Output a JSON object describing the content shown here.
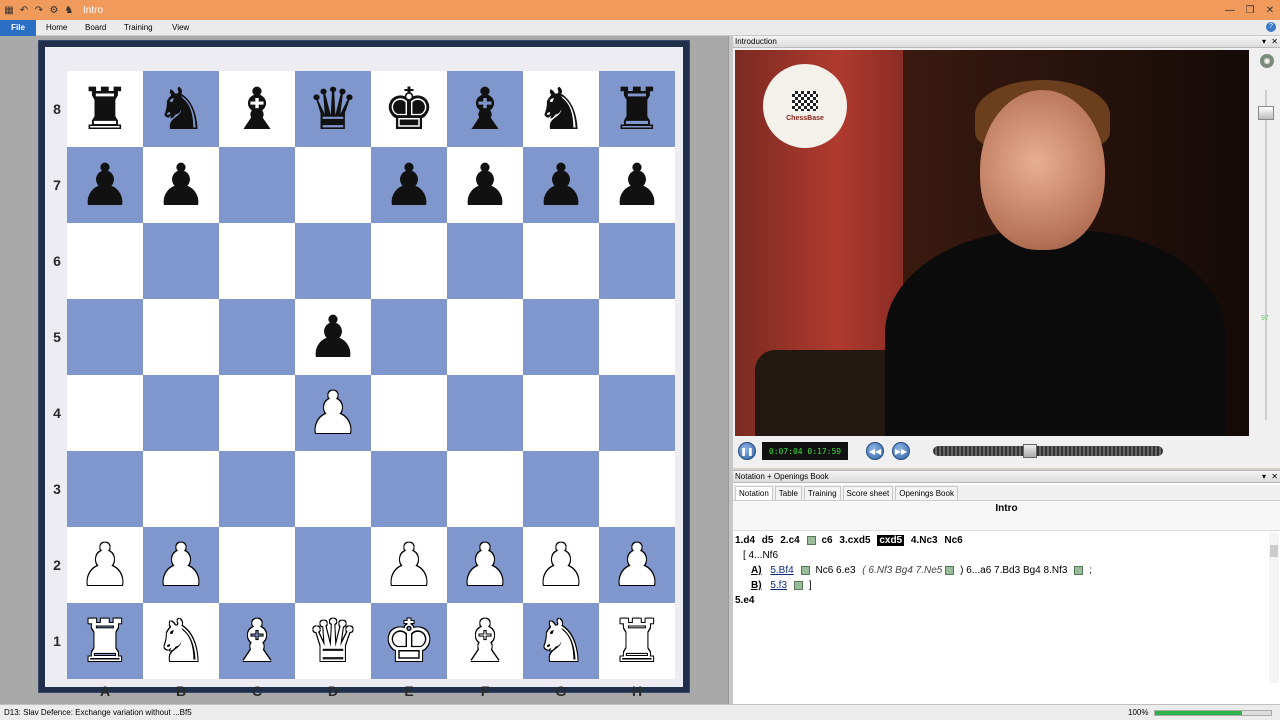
{
  "window": {
    "title": "Intro"
  },
  "menu": {
    "tabs": [
      "File",
      "Home",
      "Board",
      "Training",
      "View"
    ]
  },
  "board": {
    "files": [
      "A",
      "B",
      "C",
      "D",
      "E",
      "F",
      "G",
      "H"
    ],
    "ranks": [
      "8",
      "7",
      "6",
      "5",
      "4",
      "3",
      "2",
      "1"
    ],
    "light_color": "#ffffff",
    "dark_color": "#7f97cd",
    "position": [
      [
        "br",
        "bn",
        "bb",
        "bq",
        "bk",
        "bb",
        "bn",
        "br"
      ],
      [
        "bp",
        "bp",
        "",
        "",
        "bp",
        "bp",
        "bp",
        "bp"
      ],
      [
        "",
        "",
        "",
        "",
        "",
        "",
        "",
        ""
      ],
      [
        "",
        "",
        "",
        "bp",
        "",
        "",
        "",
        ""
      ],
      [
        "",
        "",
        "",
        "wp",
        "",
        "",
        "",
        ""
      ],
      [
        "",
        "",
        "",
        "",
        "",
        "",
        "",
        ""
      ],
      [
        "wp",
        "wp",
        "",
        "",
        "wp",
        "wp",
        "wp",
        "wp"
      ],
      [
        "wr",
        "wn",
        "wb",
        "wq",
        "wk",
        "wb",
        "wn",
        "wr"
      ]
    ]
  },
  "video_pane": {
    "title": "Introduction",
    "time": "0:07:04 0:17:59",
    "logo_text": "ChessBase",
    "volume": "97",
    "progress": 0.42
  },
  "notation_pane": {
    "title": "Notation + Openings Book",
    "tabs": [
      "Notation",
      "Table",
      "Training",
      "Score sheet",
      "Openings Book"
    ],
    "header": "Intro",
    "line1": [
      "1.d4",
      "d5",
      "2.c4",
      "c6",
      "3.cxd5",
      "cxd5",
      "4.Nc3",
      "Nc6"
    ],
    "line2": "[ 4...Nf6",
    "variation_a": {
      "label": "A)",
      "move": "5.Bf4",
      "rest": "Nc6 6.e3",
      "sub": "( 6.Nf3 Bg4 7.Ne5",
      "after": ") 6...a6 7.Bd3 Bg4 8.Nf3",
      "end": ";"
    },
    "variation_b": {
      "label": "B)",
      "move": "5.f3",
      "end": "]"
    },
    "line5": "5.e4"
  },
  "status": {
    "text": "D13: Slav Defence: Exchange variation without ...Bf5",
    "zoom": "100%",
    "zoom_level": 0.75
  },
  "colors": {
    "title_bar": "#f09a5c",
    "file_tab": "#2a6fc4",
    "board_frame": "#202f4a"
  },
  "icons": [
    "board-icon",
    "undo-icon",
    "redo-icon",
    "engine-icon",
    "pieces-icon",
    "minimize-icon",
    "restore-icon",
    "close-icon",
    "pause-icon",
    "rewind-icon",
    "forward-icon",
    "help-icon"
  ]
}
